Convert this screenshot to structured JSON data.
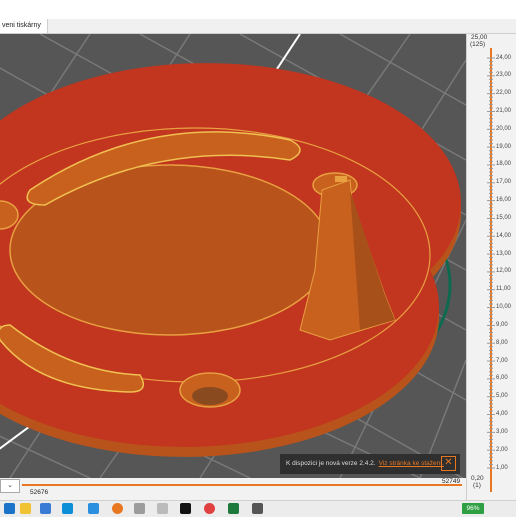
{
  "app": {
    "tab_label": "veni tiskárny"
  },
  "ruler": {
    "top_value": "25,00",
    "top_layer": "(125)",
    "bottom_value": "0,20",
    "bottom_layer": "(1)",
    "ticks": [
      "24,00",
      "23,00",
      "22,00",
      "21,00",
      "20,00",
      "19,00",
      "18,00",
      "17,00",
      "16,00",
      "15,00",
      "14,00",
      "13,00",
      "12,00",
      "11,00",
      "10,00",
      "9,00",
      "8,00",
      "7,00",
      "6,00",
      "5,00",
      "4,00",
      "3,00",
      "2,00",
      "1,00"
    ]
  },
  "hslider": {
    "left_value": "52676",
    "right_value": "52749",
    "combo_value": "v"
  },
  "notification": {
    "text": "K dispozici je nová verze 2.4.2.",
    "link": "Viz stránka ke stažení.",
    "close": "✕"
  },
  "taskbar": {
    "battery": "96%",
    "icons": [
      "start-icon",
      "file-explorer-icon",
      "store-icon",
      "skype-icon",
      "chrome-icon",
      "prusaslicer-icon",
      "cura-icon",
      "netflix-icon",
      "paint-icon",
      "excel-icon",
      "app-icon"
    ]
  },
  "colors": {
    "accent": "#e87722",
    "print_orange": "#c8601e",
    "print_red": "#c2351f",
    "skirt": "#0e6a4e",
    "bed": "#565656"
  }
}
